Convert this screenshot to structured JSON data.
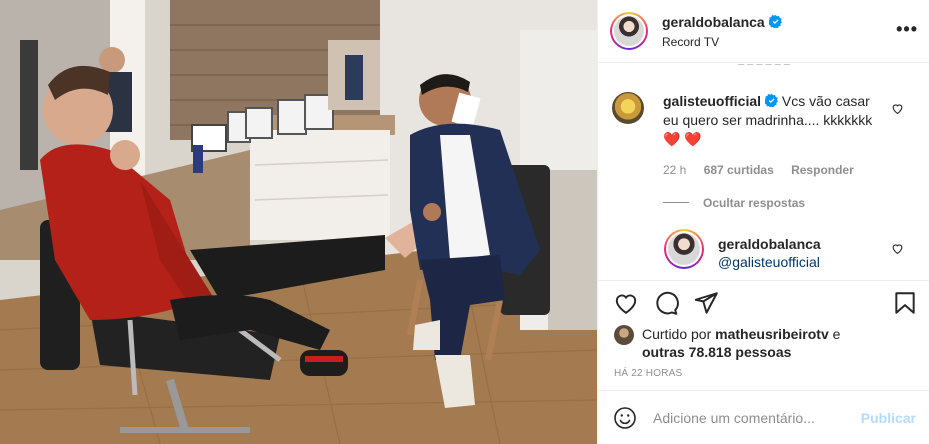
{
  "post": {
    "username": "geraldobalanca",
    "location": "Record TV",
    "more_label": "•••"
  },
  "comment1": {
    "username": "galisteuofficial",
    "text": "Vcs vão casar eu quero ser madrinha.... kkkkkkk",
    "emoji1": "❤️",
    "emoji2": "❤️",
    "age": "22 h",
    "likes": "687 curtidas",
    "reply_label": "Responder",
    "hide_replies_label": "Ocultar respostas"
  },
  "reply1": {
    "username": "geraldobalanca",
    "mention": "@galisteuofficial"
  },
  "likes": {
    "prefix": "Curtido por",
    "first_liker": "matheusribeirotv",
    "conj": "e",
    "others": "outras 78.818 pessoas"
  },
  "timestamp": "HÁ 22 HORAS",
  "add_comment": {
    "placeholder": "Adicione um comentário...",
    "publish_label": "Publicar"
  },
  "colors": {
    "verified": "#0095f6",
    "publish_disabled": "#b3dbff",
    "heart_emoji": "#e2162a"
  }
}
